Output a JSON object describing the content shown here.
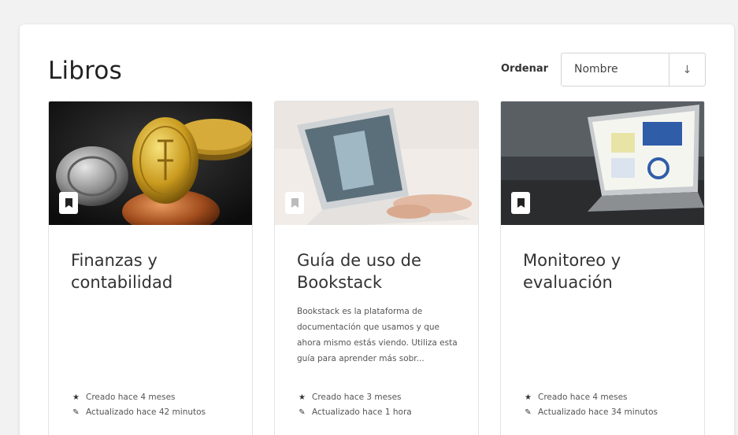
{
  "page": {
    "title": "Libros"
  },
  "sort": {
    "label": "Ordenar",
    "value": "Nombre",
    "direction_icon": "↓"
  },
  "books": [
    {
      "title": "Finanzas y contabilidad",
      "description": "",
      "created": "Creado hace 4 meses",
      "updated": "Actualizado hace 42 minutos"
    },
    {
      "title": "Guía de uso de Bookstack",
      "description": "Bookstack es la plataforma de documentación que usamos y que ahora mismo estás viendo. Utiliza esta guía para aprender más sobr...",
      "created": "Creado hace 3 meses",
      "updated": "Actualizado hace 1 hora"
    },
    {
      "title": "Monitoreo y evaluación",
      "description": "",
      "created": "Creado hace 4 meses",
      "updated": "Actualizado hace 34 minutos"
    }
  ],
  "icons": {
    "book": "bookmark-icon",
    "created": "star-icon",
    "updated": "pencil-icon"
  }
}
